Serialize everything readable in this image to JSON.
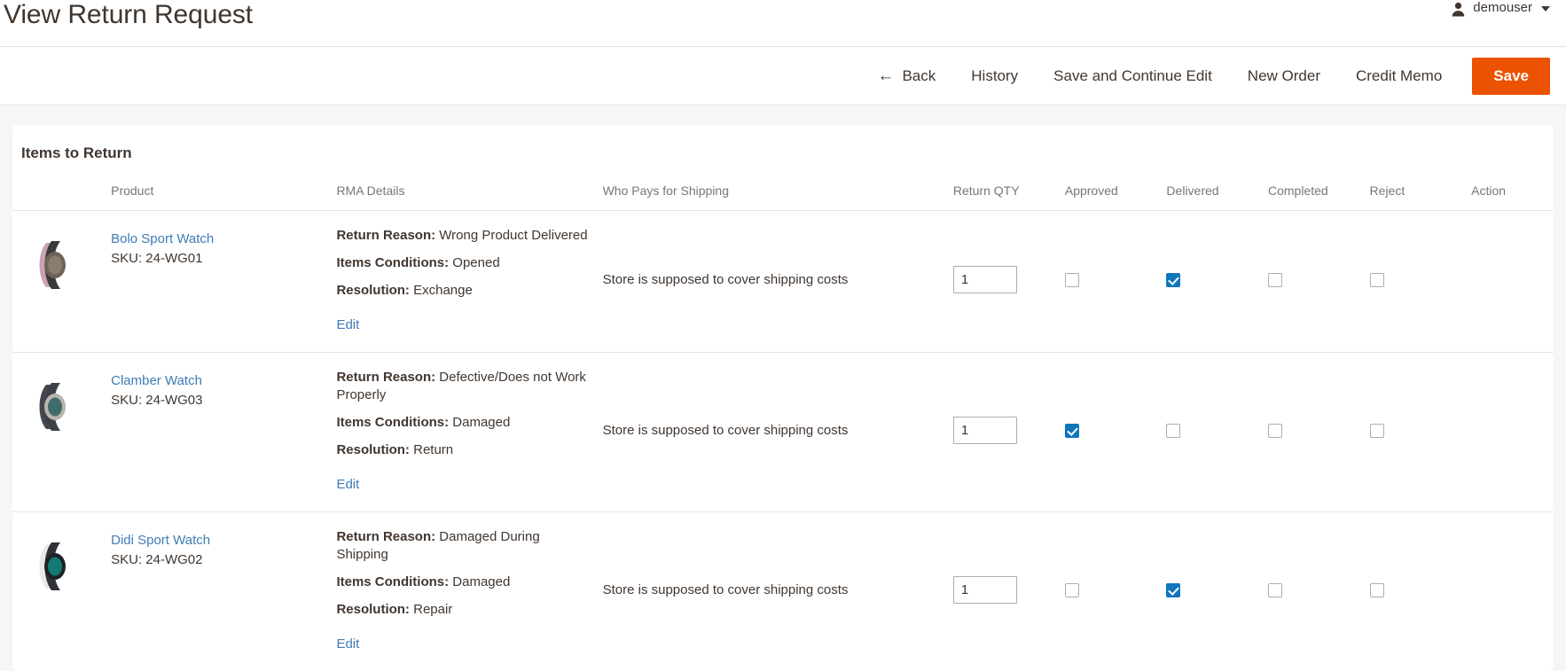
{
  "header": {
    "page_title": "View Return Request",
    "user": {
      "name": "demouser",
      "icon": "user-icon",
      "caret": "chevron-down-icon"
    }
  },
  "toolbar": {
    "back_label": "Back",
    "back_icon": "←",
    "history_label": "History",
    "save_continue_label": "Save and Continue Edit",
    "new_order_label": "New Order",
    "credit_memo_label": "Credit Memo",
    "save_label": "Save",
    "save_color": "#eb5202"
  },
  "panel": {
    "title": "Items to Return",
    "columns": [
      "Product",
      "RMA Details",
      "Who Pays for Shipping",
      "Return QTY",
      "Approved",
      "Delivered",
      "Completed",
      "Reject",
      "Action"
    ],
    "labels": {
      "return_reason": "Return Reason:",
      "items_conditions": "Items Conditions:",
      "resolution": "Resolution:",
      "edit": "Edit"
    },
    "rows": [
      {
        "product_name": "Bolo Sport Watch",
        "sku": "SKU: 24-WG01",
        "thumb": "watch-thumbnail-bolo",
        "return_reason": "Wrong Product Delivered",
        "items_conditions": "Opened",
        "resolution": "Exchange",
        "edit": "Edit",
        "who_pays": "Store is supposed to cover shipping costs",
        "qty": "1",
        "approved": false,
        "delivered": true,
        "completed": false,
        "reject": false,
        "action": ""
      },
      {
        "product_name": "Clamber Watch",
        "sku": "SKU: 24-WG03",
        "thumb": "watch-thumbnail-clamber",
        "return_reason": "Defective/Does not Work Properly",
        "items_conditions": "Damaged",
        "resolution": "Return",
        "edit": "Edit",
        "who_pays": "Store is supposed to cover shipping costs",
        "qty": "1",
        "approved": true,
        "delivered": false,
        "completed": false,
        "reject": false,
        "action": ""
      },
      {
        "product_name": "Didi Sport Watch",
        "sku": "SKU: 24-WG02",
        "thumb": "watch-thumbnail-didi",
        "return_reason": "Damaged During Shipping",
        "items_conditions": "Damaged",
        "resolution": "Repair",
        "edit": "Edit",
        "who_pays": "Store is supposed to cover shipping costs",
        "qty": "1",
        "approved": false,
        "delivered": true,
        "completed": false,
        "reject": false,
        "action": ""
      }
    ]
  }
}
